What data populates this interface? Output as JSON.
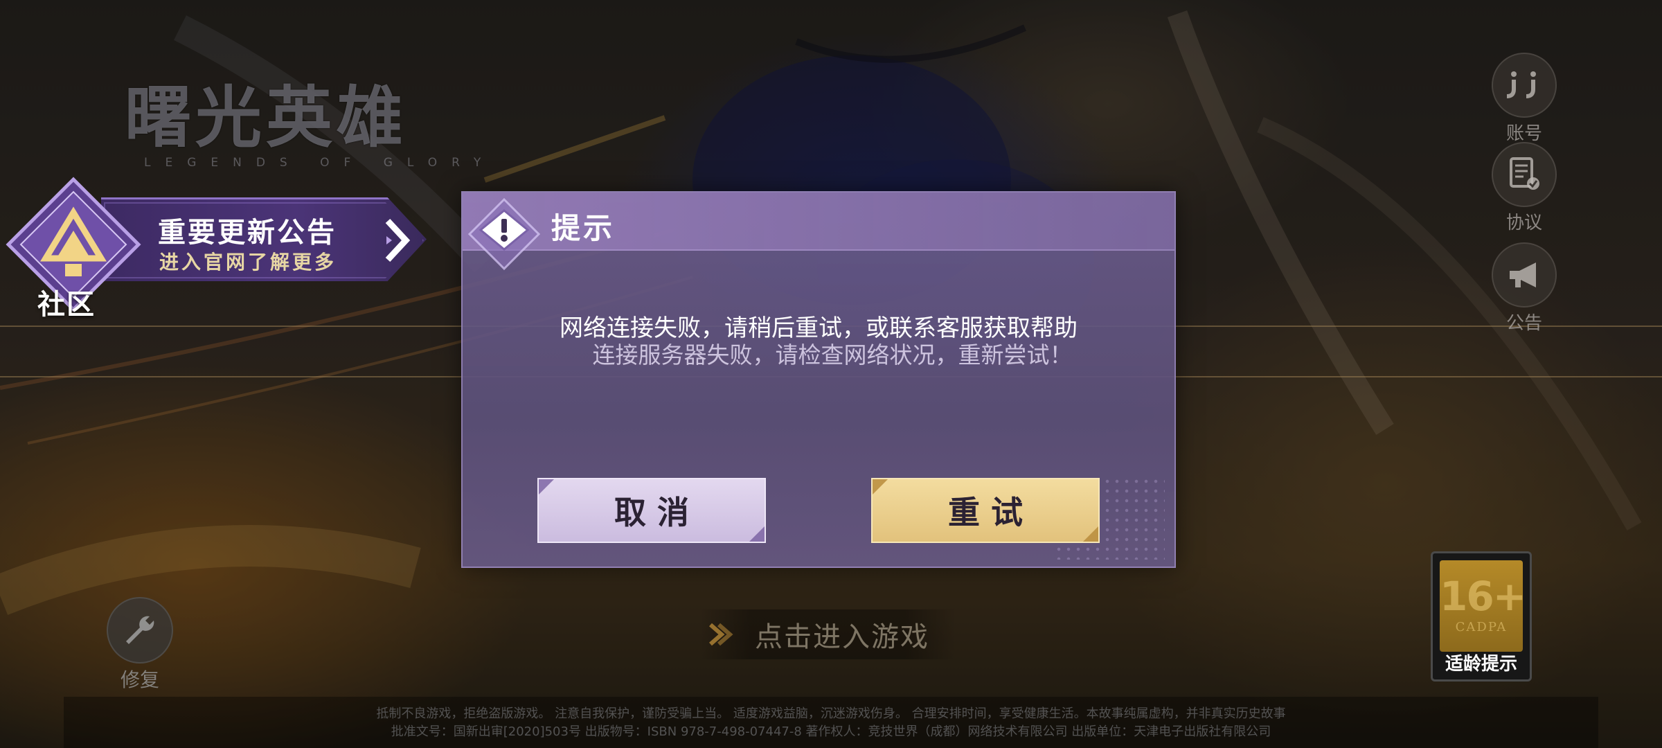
{
  "logo": {
    "title": "曙光英雄",
    "subtitle": "LEGENDS OF GLORY"
  },
  "announcement": {
    "title": "重要更新公告",
    "subtitle": "进入官网了解更多",
    "community_label": "社区"
  },
  "side_buttons": [
    {
      "label": "账号",
      "icon": "account-icon"
    },
    {
      "label": "协议",
      "icon": "agreement-icon"
    },
    {
      "label": "公告",
      "icon": "megaphone-icon"
    }
  ],
  "dialog": {
    "title": "提示",
    "message_primary": "网络连接失败，请稍后重试，或联系客服获取帮助",
    "message_secondary": "连接服务器失败，请检查网络状况，重新尝试！",
    "cancel_label": "取消",
    "retry_label": "重试"
  },
  "repair": {
    "label": "修复",
    "icon": "wrench-icon"
  },
  "enter_game": {
    "label": "点击进入游戏"
  },
  "age_rating": {
    "number": "16+",
    "org": "CADPA",
    "label": "适龄提示"
  },
  "footer": {
    "line1": "抵制不良游戏，拒绝盗版游戏。 注意自我保护，谨防受骗上当。 适度游戏益脑，沉迷游戏伤身。 合理安排时间，享受健康生活。本故事纯属虚构，并非真实历史故事",
    "line2": "批准文号：国新出审[2020]503号  出版物号：ISBN 978-7-498-07447-8  著作权人：竞技世界（成都）网络技术有限公司  出版单位：天津电子出版社有限公司"
  },
  "colors": {
    "dialog_bg": "#5c507a",
    "dialog_header": "#967db9",
    "cancel_button": "#d8cce8",
    "retry_button": "#ecd08c",
    "announce_text": "#e7d6a4"
  }
}
